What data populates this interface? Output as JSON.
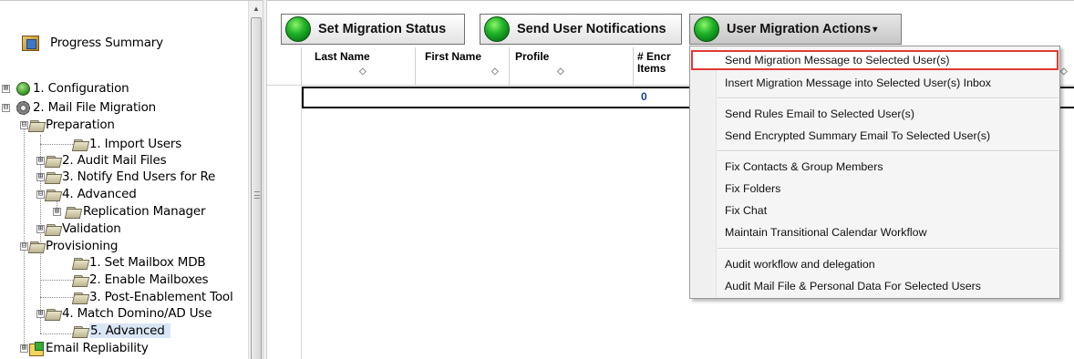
{
  "tree": {
    "items": [
      {
        "label": "Progress Summary"
      },
      {
        "label": "1. Configuration"
      },
      {
        "label": "2. Mail File Migration"
      },
      {
        "label": "Preparation"
      },
      {
        "label": "1. Import Users"
      },
      {
        "label": "2. Audit Mail Files"
      },
      {
        "label": "3. Notify End Users for Re"
      },
      {
        "label": "4. Advanced"
      },
      {
        "label": "Replication Manager"
      },
      {
        "label": "Validation"
      },
      {
        "label": "Provisioning"
      },
      {
        "label": "1. Set Mailbox MDB"
      },
      {
        "label": "2. Enable Mailboxes"
      },
      {
        "label": "3. Post-Enablement Tool"
      },
      {
        "label": "4. Match Domino/AD Use"
      },
      {
        "label": "5. Advanced"
      },
      {
        "label": "Email Repliability"
      }
    ]
  },
  "toolbar": {
    "set_status_label": "Set Migration Status",
    "send_notifications_label": "Send User Notifications",
    "user_actions_label": "User Migration Actions",
    "dropdown_caret": "▾"
  },
  "grid": {
    "columns": [
      "Last Name",
      "First Name",
      "Profile",
      "# Encr Items"
    ],
    "row": {
      "encrypted_items": "0"
    }
  },
  "menu": {
    "items": [
      "Send Migration Message to Selected User(s)",
      "Insert Migration Message into Selected User(s) Inbox",
      "Send Rules Email to Selected User(s)",
      "Send Encrypted Summary Email To Selected User(s)",
      "Fix Contacts & Group Members",
      "Fix Folders",
      "Fix Chat",
      "Maintain Transitional Calendar Workflow",
      "Audit workflow and delegation",
      "Audit Mail File & Personal Data For Selected Users"
    ],
    "highlight_color": "#e03a36"
  },
  "icons": {
    "expand": "⊞",
    "collapse": "⊟",
    "sort": "◇",
    "scroll_up": "▲"
  }
}
